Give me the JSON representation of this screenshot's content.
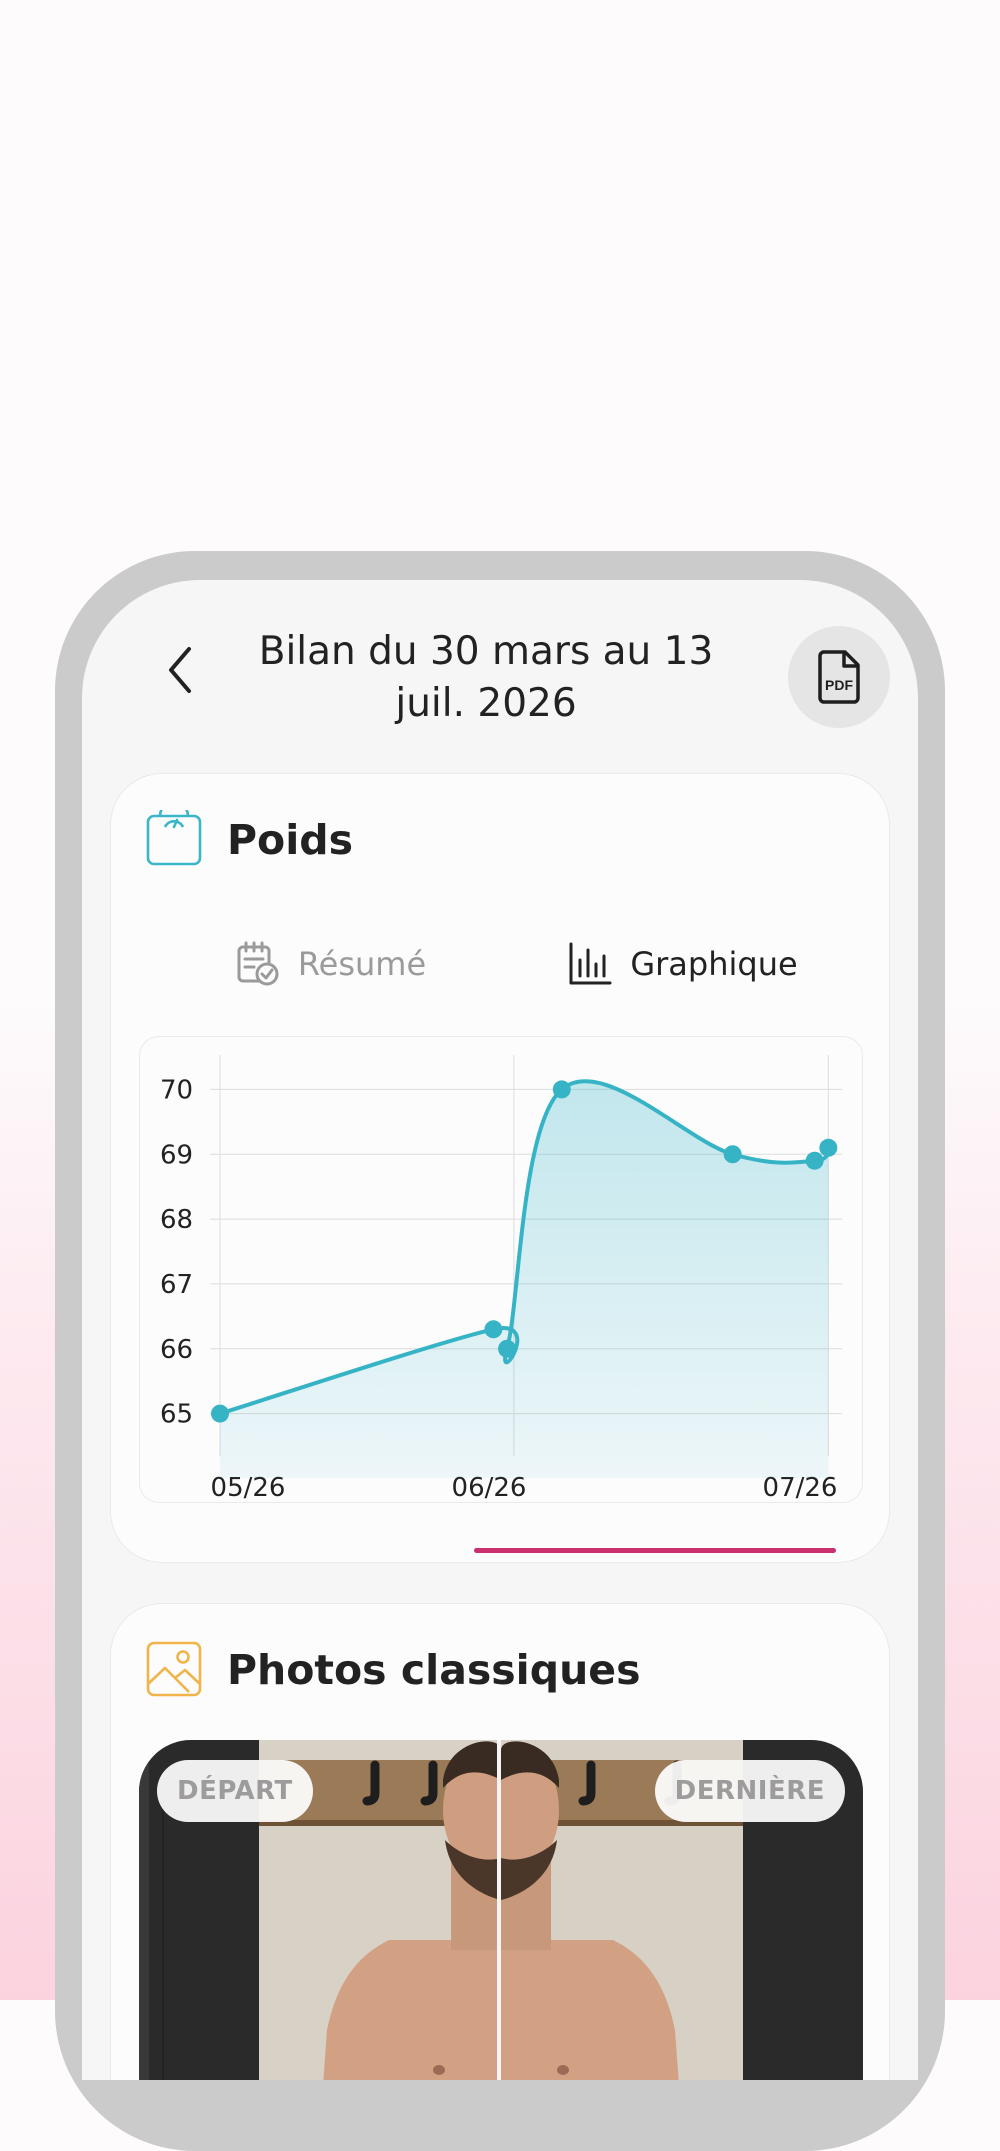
{
  "header": {
    "title": "Bilan du 30 mars au 13 juil. 2026",
    "back_icon": "chevron-left-icon",
    "pdf_icon": "pdf-file-icon",
    "pdf_icon_text": "PDF"
  },
  "weight_card": {
    "title": "Poids",
    "icon": "scale-icon",
    "icon_color": "#3ab6c8",
    "tabs": [
      {
        "label": "Résumé",
        "icon": "calendar-check-icon",
        "selected": false
      },
      {
        "label": "Graphique",
        "icon": "bar-chart-icon",
        "selected": true
      }
    ],
    "tab_indicator_color": "#c9306d"
  },
  "chart_data": {
    "type": "area",
    "series": [
      {
        "color": "#36b4c6",
        "points": [
          {
            "x": "2026-04-27",
            "y": 65.0
          },
          {
            "x": "2026-06-06",
            "y": 66.3
          },
          {
            "x": "2026-06-08",
            "y": 66.0
          },
          {
            "x": "2026-06-16",
            "y": 70.0
          },
          {
            "x": "2026-07-11",
            "y": 69.0
          },
          {
            "x": "2026-07-23",
            "y": 68.9
          },
          {
            "x": "2026-07-25",
            "y": 69.1
          }
        ]
      }
    ],
    "y_ticks": [
      "70",
      "69",
      "68",
      "67",
      "66",
      "65"
    ],
    "x_ticks": [
      "05/26",
      "06/26",
      "07/26"
    ],
    "ylim": [
      64.5,
      70.5
    ],
    "grid": true
  },
  "photos_card": {
    "title": "Photos classiques",
    "icon": "image-icon",
    "icon_color": "#f0b44a",
    "badge_start": "DÉPART",
    "badge_last": "DERNIÈRE"
  }
}
